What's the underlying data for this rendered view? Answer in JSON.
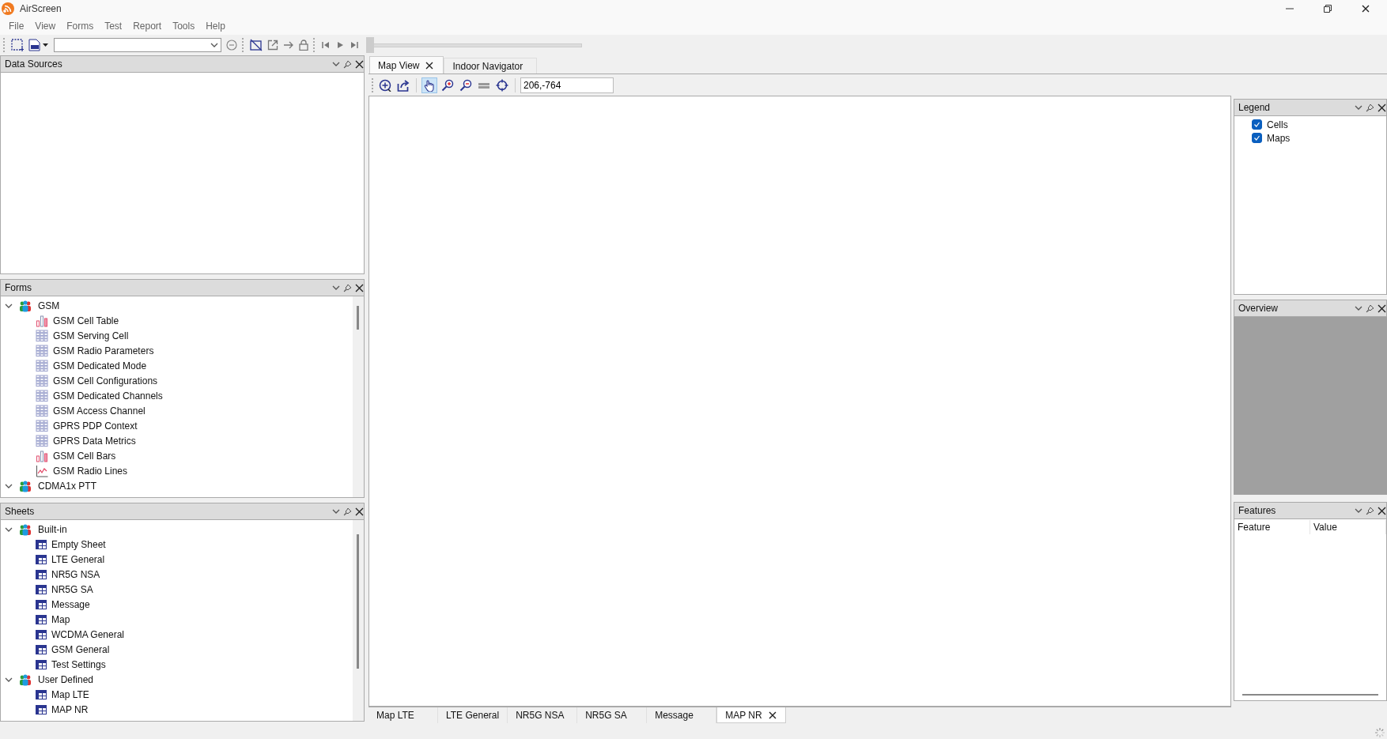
{
  "window": {
    "title": "AirScreen"
  },
  "menu": [
    "File",
    "View",
    "Forms",
    "Test",
    "Report",
    "Tools",
    "Help"
  ],
  "playback_slider": {
    "level": 0
  },
  "left_panels": [
    {
      "title": "Data Sources"
    },
    {
      "title": "Forms",
      "tree": [
        {
          "label": "GSM",
          "expanded": true,
          "children": [
            {
              "label": "GSM Cell Table",
              "kind": "bars"
            },
            {
              "label": "GSM Serving Cell",
              "kind": "grid"
            },
            {
              "label": "GSM Radio Parameters",
              "kind": "grid"
            },
            {
              "label": "GSM Dedicated Mode",
              "kind": "grid"
            },
            {
              "label": "GSM Cell Configurations",
              "kind": "grid"
            },
            {
              "label": "GSM Dedicated Channels",
              "kind": "grid"
            },
            {
              "label": "GSM Access Channel",
              "kind": "grid"
            },
            {
              "label": "GPRS PDP Context",
              "kind": "grid"
            },
            {
              "label": "GPRS Data Metrics",
              "kind": "grid"
            },
            {
              "label": "GSM Cell Bars",
              "kind": "bars"
            },
            {
              "label": "GSM Radio Lines",
              "kind": "lines"
            }
          ]
        },
        {
          "label": "CDMA1x PTT",
          "expanded": true
        }
      ]
    },
    {
      "title": "Sheets",
      "tree": [
        {
          "label": "Built-in",
          "expanded": true,
          "children": [
            {
              "label": "Empty Sheet",
              "kind": "sheet"
            },
            {
              "label": "LTE General",
              "kind": "sheet"
            },
            {
              "label": "NR5G NSA",
              "kind": "sheet"
            },
            {
              "label": "NR5G SA",
              "kind": "sheet"
            },
            {
              "label": "Message",
              "kind": "sheet"
            },
            {
              "label": "Map",
              "kind": "sheet"
            },
            {
              "label": "WCDMA General",
              "kind": "sheet"
            },
            {
              "label": "GSM General",
              "kind": "sheet"
            },
            {
              "label": "Test Settings",
              "kind": "sheet"
            }
          ]
        },
        {
          "label": "User Defined",
          "expanded": true,
          "children": [
            {
              "label": "Map LTE",
              "kind": "sheet"
            },
            {
              "label": "MAP NR",
              "kind": "sheet"
            }
          ]
        }
      ]
    }
  ],
  "document_tabs": [
    {
      "label": "Map View",
      "selected": true,
      "closable": true
    },
    {
      "label": "Indoor Navigator",
      "selected": false,
      "closable": false
    }
  ],
  "map_tools": [
    {
      "kind": "zoom-extent",
      "selected": false
    },
    {
      "kind": "export",
      "selected": false
    },
    {
      "kind": "pan",
      "selected": true
    },
    {
      "kind": "zoom-in",
      "selected": false
    },
    {
      "kind": "zoom-out",
      "selected": false
    },
    {
      "kind": "measure",
      "selected": false
    },
    {
      "kind": "locate",
      "selected": false
    }
  ],
  "coordinates": "206,-764",
  "legend": {
    "title": "Legend",
    "items": [
      {
        "label": "Cells",
        "checked": true
      },
      {
        "label": "Maps",
        "checked": true
      }
    ]
  },
  "overview": {
    "title": "Overview"
  },
  "features": {
    "title": "Features",
    "columns": [
      "Feature",
      "Value"
    ]
  },
  "sheet_tabs": [
    {
      "label": "Map LTE",
      "selected": false,
      "closable": false
    },
    {
      "label": "LTE General",
      "selected": false,
      "closable": false
    },
    {
      "label": "NR5G NSA",
      "selected": false,
      "closable": false
    },
    {
      "label": "NR5G SA",
      "selected": false,
      "closable": false
    },
    {
      "label": "Message",
      "selected": false,
      "closable": false
    },
    {
      "label": "MAP NR",
      "selected": true,
      "closable": true
    }
  ]
}
